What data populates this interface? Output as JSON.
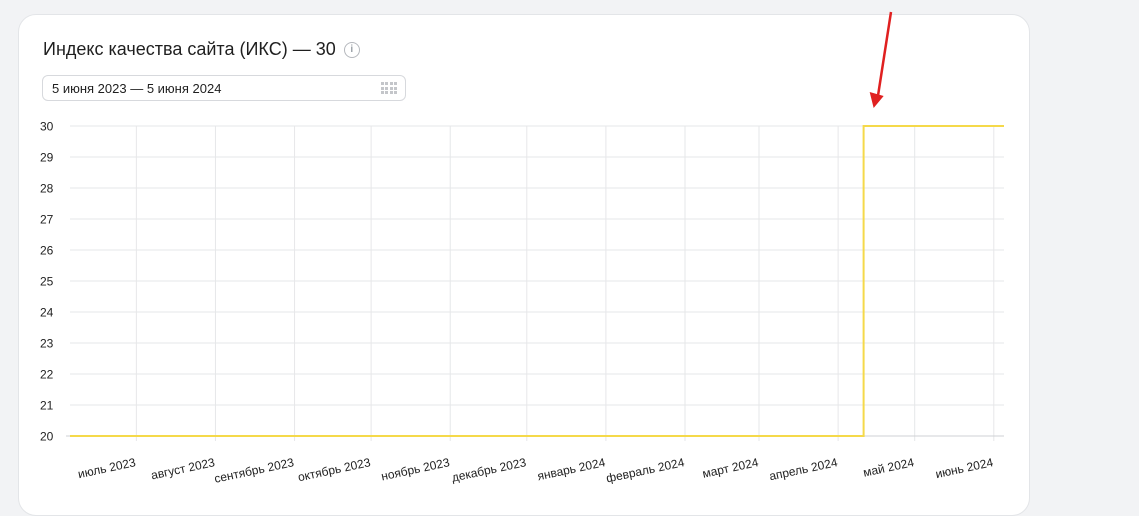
{
  "header": {
    "title": "Индекс качества сайта (ИКС) — 30",
    "info_icon": "info-icon"
  },
  "date_range": {
    "value": "5 июня 2023 — 5 июня 2024",
    "icon": "calendar-icon"
  },
  "annotation": {
    "type": "red-arrow",
    "color": "#e02020",
    "points_to": "jump to 30 in April 2024"
  },
  "chart_data": {
    "type": "line",
    "line_style": "step",
    "x_type": "date",
    "xlim": [
      "2023-06-05",
      "2024-06-05"
    ],
    "ylim": [
      20,
      30
    ],
    "yticks": [
      20,
      21,
      22,
      23,
      24,
      25,
      26,
      27,
      28,
      29,
      30
    ],
    "xticks": [
      {
        "date": "2023-07-01",
        "label": "июль 2023"
      },
      {
        "date": "2023-08-01",
        "label": "август 2023"
      },
      {
        "date": "2023-09-01",
        "label": "сентябрь 2023"
      },
      {
        "date": "2023-10-01",
        "label": "октябрь 2023"
      },
      {
        "date": "2023-11-01",
        "label": "ноябрь 2023"
      },
      {
        "date": "2023-12-01",
        "label": "декабрь 2023"
      },
      {
        "date": "2024-01-01",
        "label": "январь 2024"
      },
      {
        "date": "2024-02-01",
        "label": "февраль 2024"
      },
      {
        "date": "2024-03-01",
        "label": "март 2024"
      },
      {
        "date": "2024-04-01",
        "label": "апрель 2024"
      },
      {
        "date": "2024-05-01",
        "label": "май 2024"
      },
      {
        "date": "2024-06-01",
        "label": "июнь 2024"
      }
    ],
    "grid": true,
    "series": [
      {
        "color": "#f5d94a",
        "points": [
          {
            "x": "2023-06-05",
            "y": 20
          },
          {
            "x": "2024-04-11",
            "y": 20
          },
          {
            "x": "2024-04-11",
            "y": 30
          },
          {
            "x": "2024-06-05",
            "y": 30
          }
        ]
      }
    ]
  }
}
